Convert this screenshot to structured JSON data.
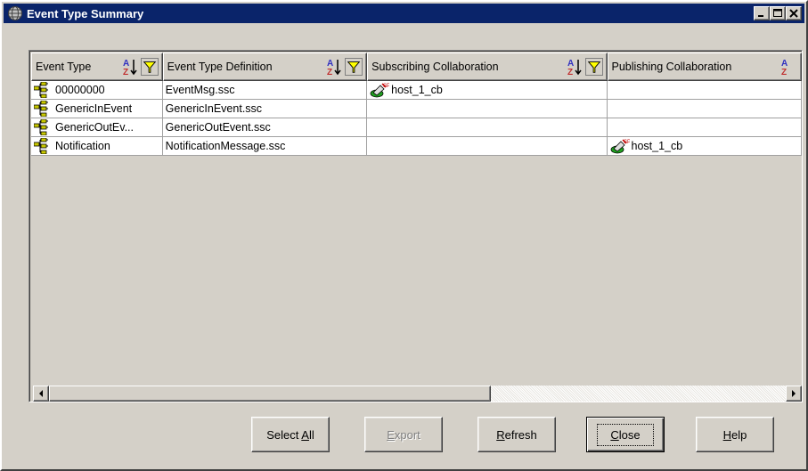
{
  "window": {
    "title": "Event Type Summary",
    "icon": "globe-app-icon",
    "controls": [
      "minimize-icon",
      "maximize-icon",
      "close-icon"
    ]
  },
  "table": {
    "columns": [
      {
        "label": "Event Type",
        "sort_icon": "sort-az-icon",
        "filter_icon": "filter-icon"
      },
      {
        "label": "Event Type Definition",
        "sort_icon": "sort-az-icon",
        "filter_icon": "filter-icon"
      },
      {
        "label": "Subscribing Collaboration",
        "sort_icon": "sort-az-icon",
        "filter_icon": "filter-icon"
      },
      {
        "label": "Publishing Collaboration",
        "sort_icon": "sort-az-icon"
      }
    ],
    "rows": [
      {
        "event_type": "00000000",
        "definition": "EventMsg.ssc",
        "subscribing": "host_1_cb",
        "publishing": ""
      },
      {
        "event_type": "GenericInEvent",
        "definition": "GenericInEvent.ssc",
        "subscribing": "",
        "publishing": ""
      },
      {
        "event_type": "GenericOutEv...",
        "definition": "GenericOutEvent.ssc",
        "subscribing": "",
        "publishing": ""
      },
      {
        "event_type": "Notification",
        "definition": "NotificationMessage.ssc",
        "subscribing": "",
        "publishing": "host_1_cb"
      }
    ]
  },
  "scrollbar": {
    "left_icon": "arrow-left-icon",
    "right_icon": "arrow-right-icon",
    "thumb_fraction": 0.6
  },
  "buttons": {
    "select_all": {
      "pre": "Select ",
      "mnemonic": "A",
      "post": "ll"
    },
    "export": {
      "pre": "",
      "mnemonic": "E",
      "post": "xport",
      "disabled": true
    },
    "refresh": {
      "pre": "",
      "mnemonic": "R",
      "post": "efresh"
    },
    "close": {
      "pre": "",
      "mnemonic": "C",
      "post": "lose"
    },
    "help": {
      "pre": "",
      "mnemonic": "H",
      "post": "elp"
    }
  },
  "colors": {
    "title_bar": "#0a246a",
    "window_bg": "#d4d0c8",
    "cell_bg": "#ffffff"
  }
}
